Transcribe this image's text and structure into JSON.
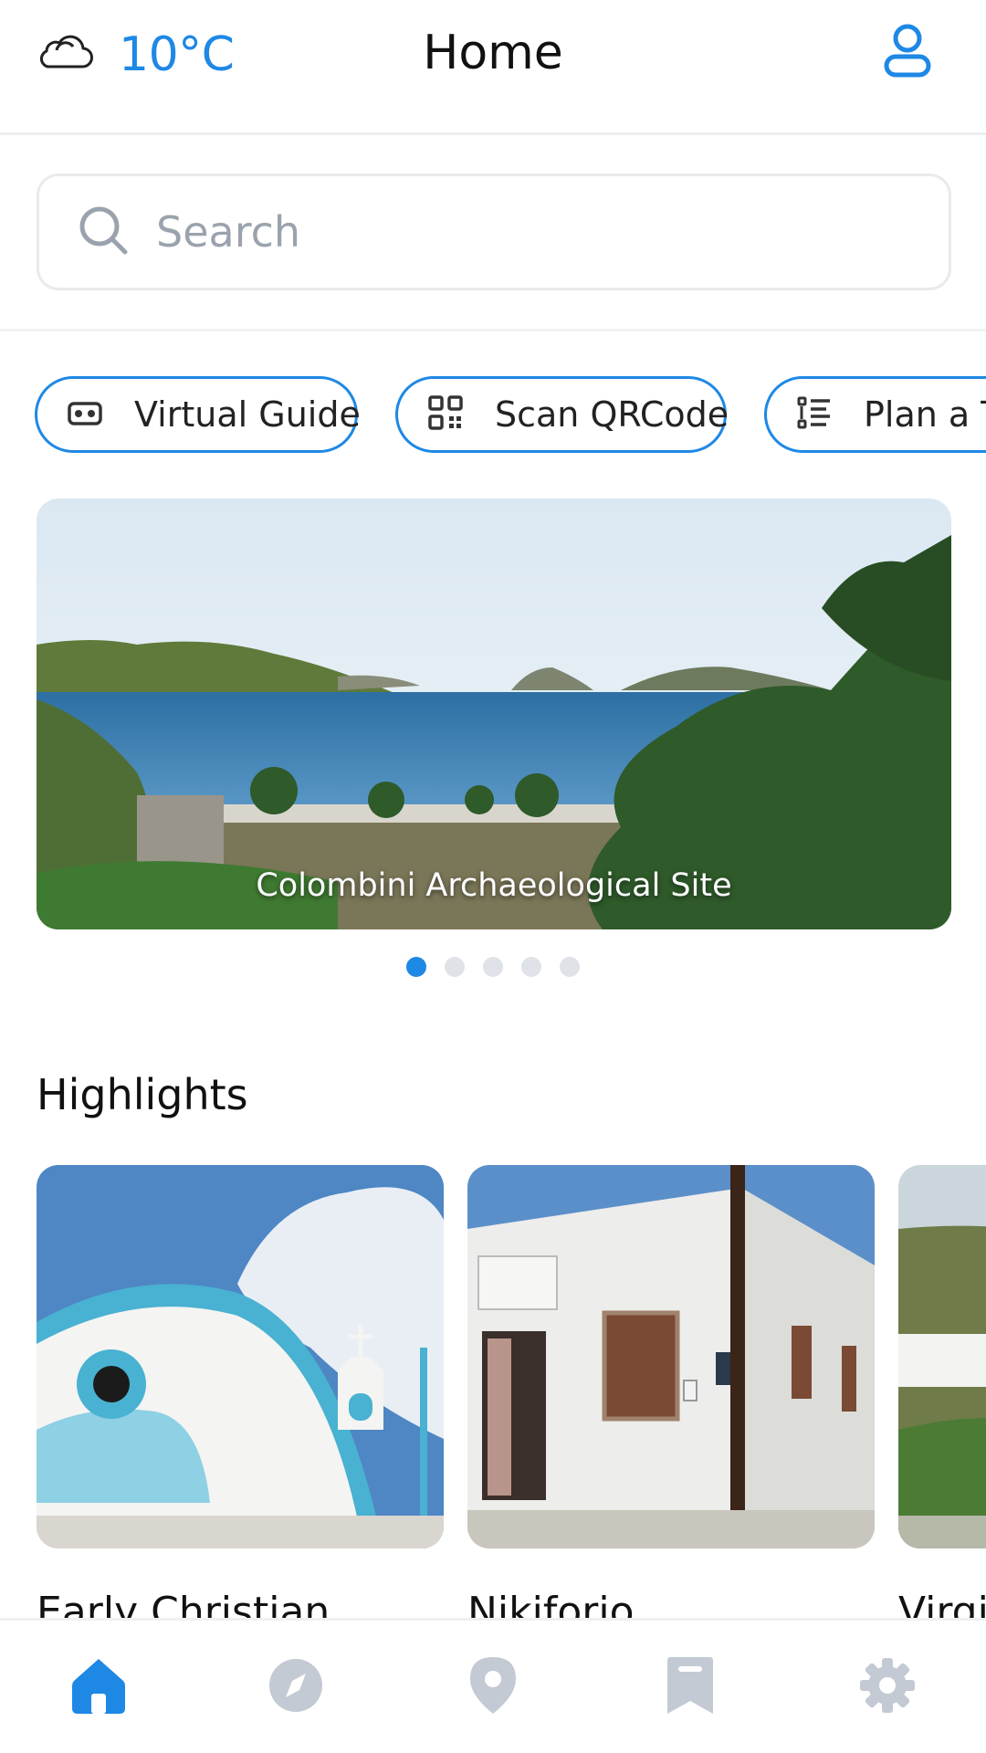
{
  "header": {
    "weather_icon": "cloud-icon",
    "temperature": "10°C",
    "title": "Home",
    "profile_icon": "user-icon"
  },
  "search": {
    "placeholder": "Search",
    "icon": "search-icon"
  },
  "quick_actions": [
    {
      "label": "Virtual Guide",
      "icon": "vr-headset-icon"
    },
    {
      "label": "Scan QRCode",
      "icon": "qr-code-icon"
    },
    {
      "label": "Plan a Tr",
      "icon": "list-icon"
    }
  ],
  "carousel": {
    "caption": "Colombini Archaeological Site",
    "pages": 5,
    "active_index": 0
  },
  "highlights": {
    "title": "Highlights",
    "items": [
      {
        "title": "Early Christian"
      },
      {
        "title": "Nikiforio"
      },
      {
        "title": "Virgi"
      }
    ]
  },
  "bottom_nav": [
    {
      "name": "home",
      "icon": "home-icon",
      "active": true
    },
    {
      "name": "explore",
      "icon": "compass-icon",
      "active": false
    },
    {
      "name": "map",
      "icon": "location-pin-icon",
      "active": false
    },
    {
      "name": "saved",
      "icon": "bookmark-icon",
      "active": false
    },
    {
      "name": "settings",
      "icon": "gear-icon",
      "active": false
    }
  ],
  "colors": {
    "accent": "#1e88e5",
    "inactive_icon": "#c3cad3",
    "dot_inactive": "#dfe3e8"
  }
}
